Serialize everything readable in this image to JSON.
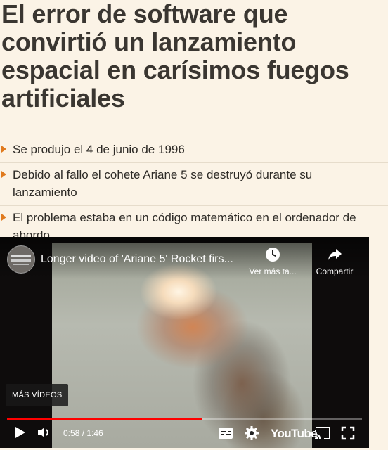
{
  "article": {
    "headline": "El error de software que convirtió un lanzamiento espacial en carísimos fuegos artificiales",
    "bullets": [
      "Se produjo el 4 de junio de 1996",
      "Debido al fallo el cohete Ariane 5 se destruyó durante su lanzamiento",
      "El problema estaba en un código matemático en el ordenador de abordo"
    ]
  },
  "video": {
    "title": "Longer video of 'Ariane 5' Rocket firs...",
    "watch_later_label": "Ver más ta...",
    "share_label": "Compartir",
    "more_videos_label": "MÁS VÍDEOS",
    "current_time": "0:58",
    "duration": "1:46",
    "time_display": "0:58 / 1:46",
    "progress_fraction": 0.55,
    "youtube_label": "YouTube",
    "icons": [
      "play-icon",
      "volume-icon",
      "subtitles-icon",
      "settings-icon",
      "cast-icon",
      "fullscreen-icon",
      "clock-icon",
      "share-icon"
    ],
    "colors": {
      "progress": "#ff0000",
      "bullet_accent": "#e07a1e"
    }
  }
}
